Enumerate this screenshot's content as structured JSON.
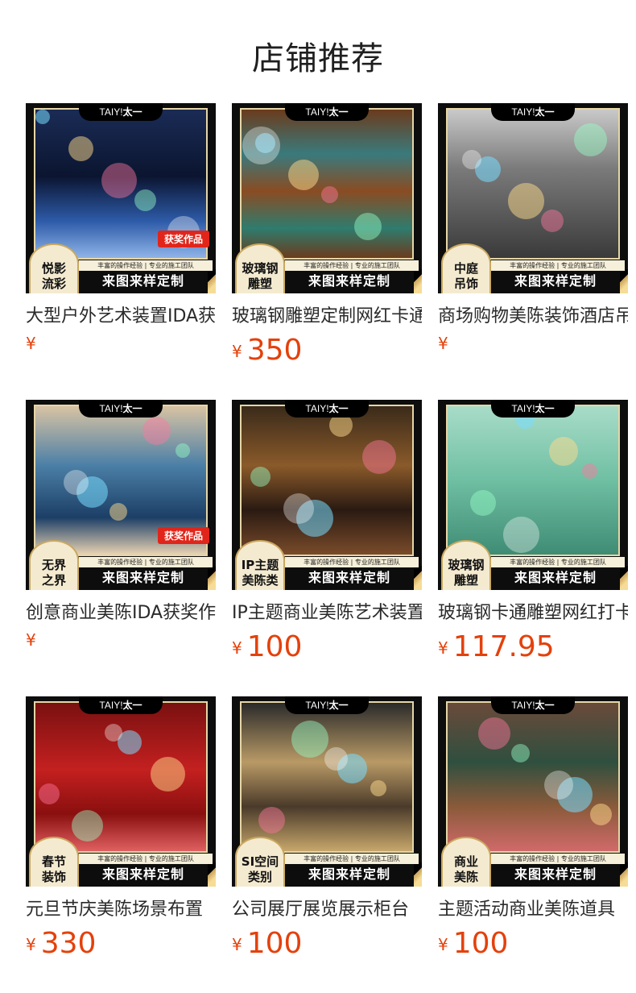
{
  "page": {
    "title": "店铺推荐"
  },
  "common": {
    "brand": "TAIY!",
    "brand_cn": "太一",
    "slogan": "丰富的操作经验 | 专业的施工团队",
    "cta": "来图来样定制",
    "award": "获奖作品",
    "currency": "¥"
  },
  "products": [
    {
      "name": "大型户外艺术装置IDA获奖作品",
      "price": "",
      "badge": "悦影\n流彩",
      "award": true
    },
    {
      "name": "玻璃钢雕塑定制网红卡通IP",
      "price": "350",
      "badge": "玻璃钢\n雕塑",
      "award": false
    },
    {
      "name": "商场购物美陈装饰酒店吊饰",
      "price": "",
      "badge": "中庭\n吊饰",
      "award": false
    },
    {
      "name": "创意商业美陈IDA获奖作品",
      "price": "",
      "badge": "无界\n之界",
      "award": true
    },
    {
      "name": "IP主题商业美陈艺术装置",
      "price": "100",
      "badge": "IP主题\n美陈类",
      "award": false
    },
    {
      "name": "玻璃钢卡通雕塑网红打卡",
      "price": "117.95",
      "badge": "玻璃钢\n雕塑",
      "award": false
    },
    {
      "name": "元旦节庆美陈场景布置",
      "price": "330",
      "badge": "春节\n装饰",
      "award": false
    },
    {
      "name": "公司展厅展览展示柜台",
      "price": "100",
      "badge": "SI空间\n类别",
      "award": false
    },
    {
      "name": "主题活动商业美陈道具",
      "price": "100",
      "badge": "商业\n美陈",
      "award": false
    }
  ]
}
